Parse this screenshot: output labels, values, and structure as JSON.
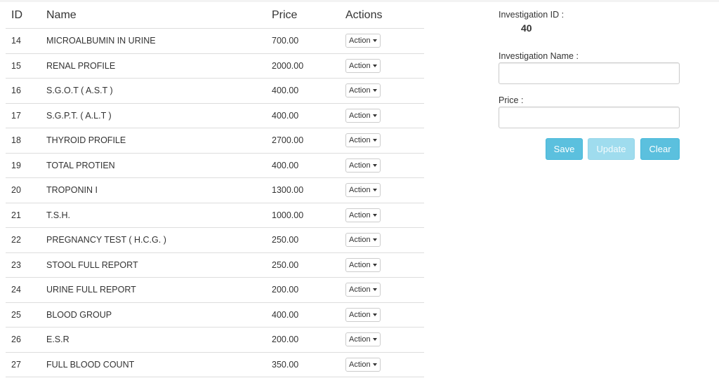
{
  "table": {
    "headers": {
      "id": "ID",
      "name": "Name",
      "price": "Price",
      "actions": "Actions"
    },
    "rows": [
      {
        "id": "14",
        "name": "MICROALBUMIN IN URINE",
        "price": "700.00",
        "action": "Action"
      },
      {
        "id": "15",
        "name": "RENAL PROFILE",
        "price": "2000.00",
        "action": "Action"
      },
      {
        "id": "16",
        "name": "S.G.O.T ( A.S.T )",
        "price": "400.00",
        "action": "Action"
      },
      {
        "id": "17",
        "name": "S.G.P.T. ( A.L.T )",
        "price": "400.00",
        "action": "Action"
      },
      {
        "id": "18",
        "name": "THYROID PROFILE",
        "price": "2700.00",
        "action": "Action"
      },
      {
        "id": "19",
        "name": "TOTAL PROTIEN",
        "price": "400.00",
        "action": "Action"
      },
      {
        "id": "20",
        "name": "TROPONIN I",
        "price": "1300.00",
        "action": "Action"
      },
      {
        "id": "21",
        "name": "T.S.H.",
        "price": "1000.00",
        "action": "Action"
      },
      {
        "id": "22",
        "name": "PREGNANCY TEST ( H.C.G. )",
        "price": "250.00",
        "action": "Action"
      },
      {
        "id": "23",
        "name": "STOOL FULL REPORT",
        "price": "250.00",
        "action": "Action"
      },
      {
        "id": "24",
        "name": "URINE FULL REPORT",
        "price": "200.00",
        "action": "Action"
      },
      {
        "id": "25",
        "name": "BLOOD GROUP",
        "price": "400.00",
        "action": "Action"
      },
      {
        "id": "26",
        "name": "E.S.R",
        "price": "200.00",
        "action": "Action"
      },
      {
        "id": "27",
        "name": "FULL BLOOD COUNT",
        "price": "350.00",
        "action": "Action"
      }
    ]
  },
  "form": {
    "id_label": "Investigation ID :",
    "id_value": "40",
    "name_label": "Investigation Name :",
    "name_value": "",
    "price_label": "Price :",
    "price_value": "",
    "save_label": "Save",
    "update_label": "Update",
    "clear_label": "Clear"
  },
  "colors": {
    "accent": "#5bc0de",
    "accent_disabled": "#9fdcee",
    "border": "#dddddd"
  }
}
